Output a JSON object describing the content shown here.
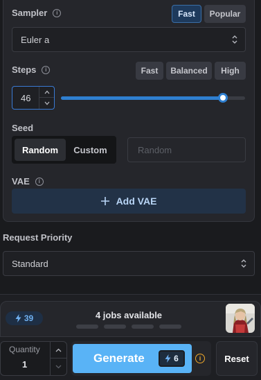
{
  "sampler": {
    "label": "Sampler",
    "presets": [
      "Fast",
      "Popular"
    ],
    "value": "Euler a"
  },
  "steps": {
    "label": "Steps",
    "presets": [
      "Fast",
      "Balanced",
      "High"
    ],
    "value": "46",
    "slider_fraction": 0.88
  },
  "seed": {
    "label": "Seed",
    "modes": [
      "Random",
      "Custom"
    ],
    "selected_mode": "Random",
    "placeholder": "Random"
  },
  "vae": {
    "label": "VAE",
    "add_label": "Add VAE"
  },
  "priority": {
    "label": "Request Priority",
    "value": "Standard"
  },
  "status": {
    "kudos": "39",
    "jobs": "4 jobs available"
  },
  "actions": {
    "quantity_label": "Quantity",
    "quantity_value": "1",
    "generate_label": "Generate",
    "generate_cost": "6",
    "reset_label": "Reset"
  },
  "colors": {
    "accent": "#59b3f6",
    "slider": "#2f7fd0",
    "warning": "#f0a92b"
  }
}
